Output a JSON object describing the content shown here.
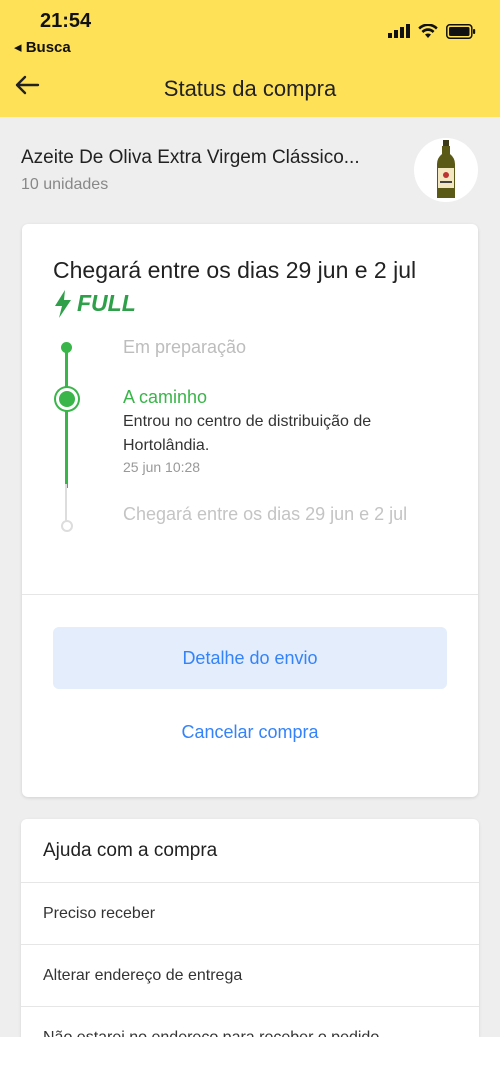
{
  "status_bar": {
    "time": "21:54",
    "back_app": "◂ Busca"
  },
  "navbar": {
    "title": "Status da compra",
    "back_icon": "arrow-left-icon"
  },
  "product": {
    "name": "Azeite De Oliva Extra Virgem Clássico...",
    "quantity": "10 unidades",
    "image_icon": "olive-oil-bottle"
  },
  "shipment": {
    "eta": "Chegará entre os dias 29 jun e 2 jul",
    "badge": "FULL",
    "badge_color": "#2fa04a",
    "steps": [
      {
        "title": "Em preparação"
      },
      {
        "title": "A caminho",
        "description": "Entrou no centro de distribuição de Hortolândia.",
        "date": "25 jun 10:28"
      },
      {
        "title": "Chegará entre os dias 29 jun e 2 jul"
      }
    ],
    "detail_button": "Detalhe do envio",
    "cancel_link": "Cancelar compra"
  },
  "help": {
    "title": "Ajuda com a compra",
    "items": [
      "Preciso receber",
      "Alterar endereço de entrega",
      "Não estarei no endereço para receber o pedido"
    ]
  },
  "colors": {
    "header_yellow": "#fee156",
    "green": "#39b54a",
    "link_blue": "#3483fa",
    "background_gray": "#eeeeee"
  }
}
